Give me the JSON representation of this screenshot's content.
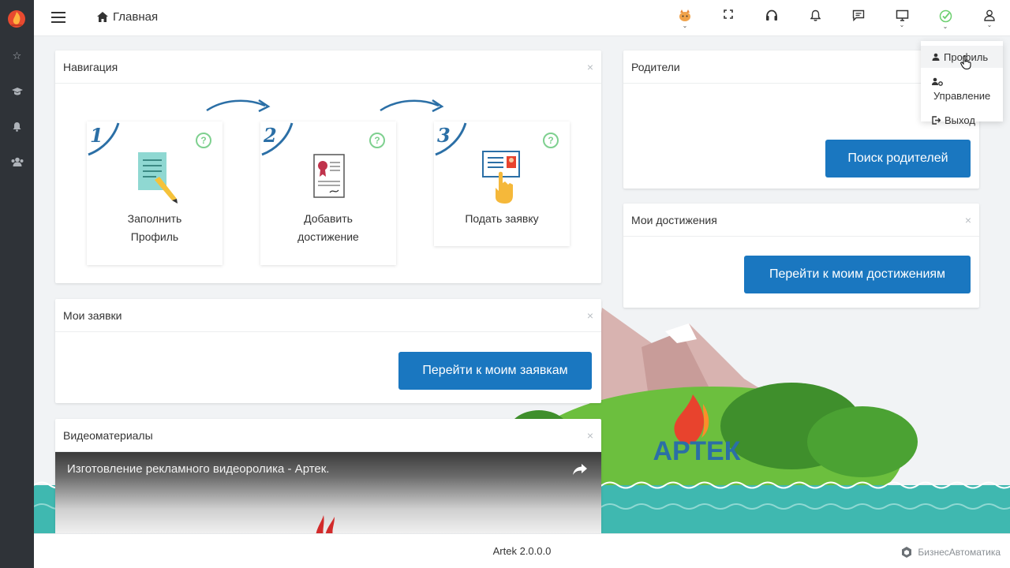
{
  "header": {
    "breadcrumb": "Главная",
    "icons": [
      "pet-icon",
      "fullscreen-icon",
      "headset-icon",
      "bell-icon",
      "chat-icon",
      "monitor-icon",
      "status-check-icon",
      "user-icon"
    ]
  },
  "sidebar": {
    "icons": [
      "logo-flame",
      "star-icon",
      "graduation-cap-icon",
      "bell-icon",
      "users-icon"
    ]
  },
  "navigation_panel": {
    "title": "Навигация",
    "close": "×",
    "steps": [
      {
        "number": "1",
        "line1": "Заполнить",
        "line2": "Профиль",
        "help": "?"
      },
      {
        "number": "2",
        "line1": "Добавить",
        "line2": "достижение",
        "help": "?"
      },
      {
        "number": "3",
        "line1": "Подать заявку",
        "line2": "",
        "help": "?"
      }
    ]
  },
  "applications_panel": {
    "title": "Мои заявки",
    "close": "×",
    "button": "Перейти к моим заявкам"
  },
  "video_panel": {
    "title": "Видеоматериалы",
    "close": "×",
    "video_title": "Изготовление рекламного видеоролика - Артек."
  },
  "parents_panel": {
    "title": "Родители",
    "button": "Поиск родителей"
  },
  "achievements_panel": {
    "title": "Мои достижения",
    "close": "×",
    "button": "Перейти к моим достижениям"
  },
  "user_menu": {
    "items": [
      {
        "label": "Профиль",
        "icon": "person-icon"
      },
      {
        "label": "Управление",
        "icon": "people-gear-icon"
      },
      {
        "label": "Выход",
        "icon": "logout-icon"
      }
    ]
  },
  "background": {
    "logo_text": "АРТЕК"
  },
  "footer": {
    "version": "Artek 2.0.0.0",
    "vendor": "БизнесАвтоматика"
  },
  "colors": {
    "primary_button": "#1a77c0",
    "sidebar_bg": "#2f3338",
    "help_green": "#7ed08f",
    "sea": "#3fb8b0"
  }
}
